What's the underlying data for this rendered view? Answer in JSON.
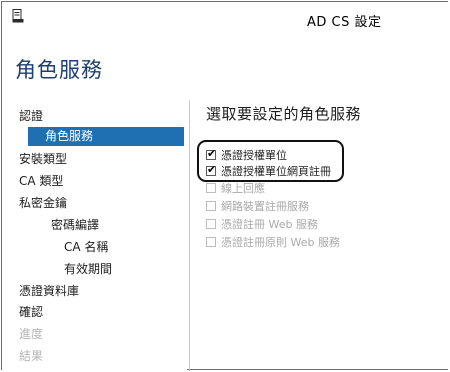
{
  "window": {
    "title": "AD CS 設定"
  },
  "header": {
    "page_title": "角色服務"
  },
  "nav": {
    "items": [
      {
        "label": "認證",
        "state": "normal"
      },
      {
        "label": "角色服務",
        "state": "selected"
      },
      {
        "label": "安裝類型",
        "state": "normal"
      },
      {
        "label": "CA 類型",
        "state": "normal"
      },
      {
        "label": "私密金鑰",
        "state": "normal"
      },
      {
        "label": "密碼編譯",
        "state": "sub"
      },
      {
        "label": "CA 名稱",
        "state": "sub2"
      },
      {
        "label": "有效期間",
        "state": "sub2"
      },
      {
        "label": "憑證資料庫",
        "state": "normal"
      },
      {
        "label": "確認",
        "state": "normal"
      },
      {
        "label": "進度",
        "state": "disabled"
      },
      {
        "label": "結果",
        "state": "disabled"
      }
    ]
  },
  "main": {
    "heading": "選取要設定的角色服務",
    "options": [
      {
        "label": "憑證授權單位",
        "checked": true,
        "enabled": true
      },
      {
        "label": "憑證授權單位網頁註冊",
        "checked": true,
        "enabled": true
      },
      {
        "label": "線上回應",
        "checked": false,
        "enabled": false
      },
      {
        "label": "網路裝置註冊服務",
        "checked": false,
        "enabled": false
      },
      {
        "label": "憑證註冊 Web 服務",
        "checked": false,
        "enabled": false
      },
      {
        "label": "憑證註冊原則 Web 服務",
        "checked": false,
        "enabled": false
      }
    ]
  },
  "colors": {
    "selected_nav_bg": "#1f70b3",
    "title_blue": "#1e3f73",
    "disabled_text": "#a9a9a9"
  }
}
